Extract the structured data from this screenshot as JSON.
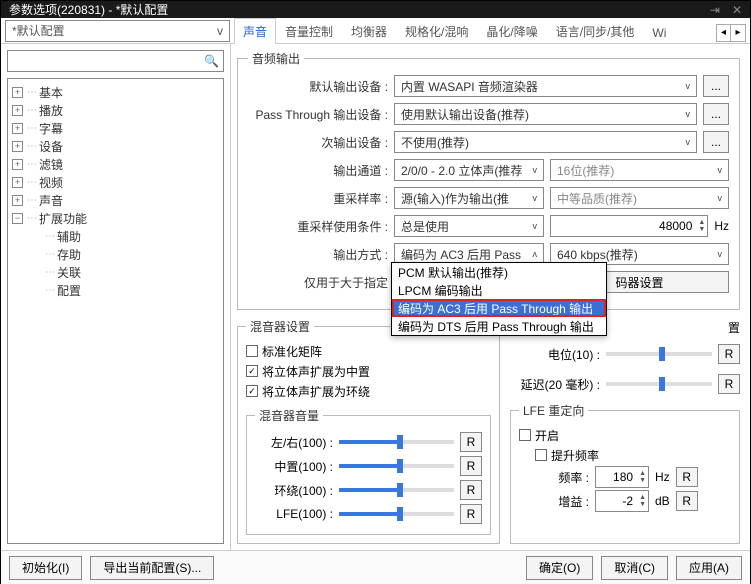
{
  "window": {
    "title": "参数选项(220831) - *默认配置"
  },
  "config_dropdown": {
    "value": "*默认配置",
    "arrow": "v"
  },
  "search": {
    "icon": "🔍"
  },
  "tabs": {
    "items": [
      "声音",
      "音量控制",
      "均衡器",
      "规格化/混响",
      "晶化/降噪",
      "语言/同步/其他",
      "Wi"
    ],
    "nav_left": "◂",
    "nav_right": "▸"
  },
  "tree": {
    "items": [
      {
        "label": "基本",
        "exp": "+"
      },
      {
        "label": "播放",
        "exp": "+"
      },
      {
        "label": "字幕",
        "exp": "+"
      },
      {
        "label": "设备",
        "exp": "+"
      },
      {
        "label": "滤镜",
        "exp": "+"
      },
      {
        "label": "视频",
        "exp": "+"
      },
      {
        "label": "声音",
        "exp": "+"
      },
      {
        "label": "扩展功能",
        "exp": "−"
      },
      {
        "label": "辅助",
        "child": true
      },
      {
        "label": "存助",
        "child": true
      },
      {
        "label": "关联",
        "child": true
      },
      {
        "label": "配置",
        "child": true
      }
    ]
  },
  "audio_output": {
    "legend": "音频输出",
    "default_device_label": "默认输出设备 :",
    "default_device_value": "内置 WASAPI 音频渲染器",
    "passthrough_label": "Pass Through 输出设备 :",
    "passthrough_value": "使用默认输出设备(推荐)",
    "secondary_label": "次输出设备 :",
    "secondary_value": "不使用(推荐)",
    "channels_label": "输出通道 :",
    "channels_value": "2/0/0 - 2.0 立体声(推荐",
    "bitdepth_value": "16位(推荐)",
    "resample_label": "重采样率 :",
    "resample_value": "源(输入)作为输出(推",
    "quality_value": "中等品质(推荐)",
    "resample_cond_label": "重采样使用条件 :",
    "resample_cond_value": "总是使用",
    "resample_hz": "48000",
    "hz_unit": "Hz",
    "output_mode_label": "输出方式 :",
    "output_mode_value": "编码为 AC3 后用 Pass",
    "output_mode_arrow": "ʌ",
    "bitrate_value": "640 kbps(推荐)",
    "only_for_label": "仅用于大于指定",
    "options": {
      "o0": "PCM 默认输出(推荐)",
      "o1": "LPCM 编码输出",
      "o2": "编码为 AC3 后用 Pass Through 输出",
      "o3": "编码为 DTS 后用 Pass Through 输出"
    },
    "codec_settings_btn": "码器设置",
    "ellipsis": "..."
  },
  "mixer": {
    "legend": "混音器设置",
    "norm_matrix": "标准化矩阵",
    "stereo_center": "将立体声扩展为中置",
    "stereo_surround": "将立体声扩展为环绕",
    "right_partial": "置",
    "level_label": "电位(10) :",
    "delay_label": "延迟(20 毫秒) :",
    "volume_legend": "混音器音量",
    "lr_label": "左/右(100) :",
    "center_label": "中置(100) :",
    "surround_label": "环绕(100) :",
    "lfe_label": "LFE(100) :",
    "r_btn": "R"
  },
  "lfe": {
    "legend": "LFE 重定向",
    "enable": "开启",
    "boost": "提升频率",
    "freq_label": "频率 :",
    "freq_value": "180",
    "hz": "Hz",
    "gain_label": "增益 :",
    "gain_value": "-2",
    "db": "dB",
    "r_btn": "R"
  },
  "footer": {
    "init": "初始化(I)",
    "export": "导出当前配置(S)...",
    "ok": "确定(O)",
    "cancel": "取消(C)",
    "apply": "应用(A)"
  }
}
